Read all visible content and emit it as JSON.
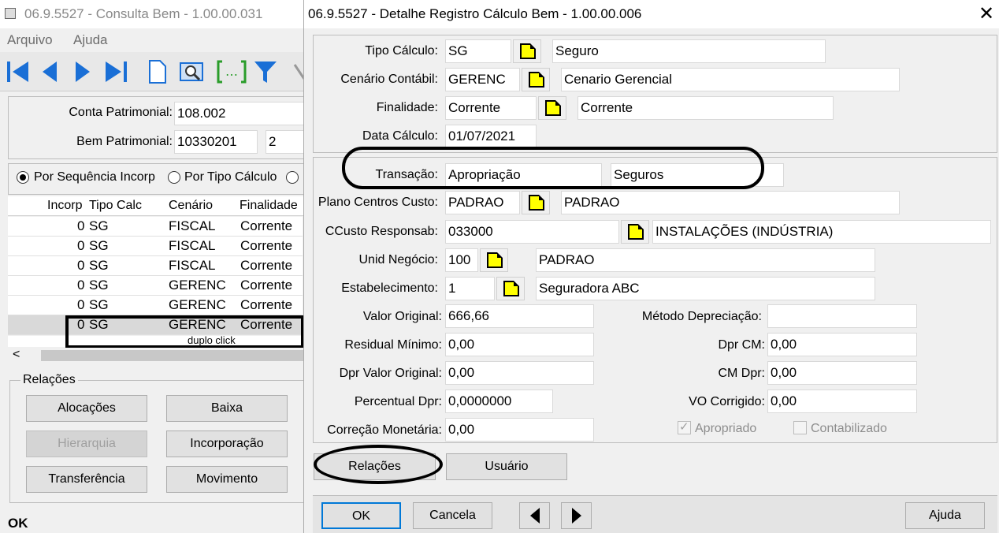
{
  "back_window": {
    "title": "06.9.5527 - Consulta Bem - 1.00.00.031",
    "menu": [
      "Arquivo",
      "Ajuda"
    ],
    "conta_patrimonial_label": "Conta Patrimonial:",
    "conta_patrimonial_value": "108.002",
    "bem_patrimonial_label": "Bem Patrimonial:",
    "bem_patrimonial_value": "10330201",
    "bem_seq_value": "2",
    "radios": [
      "Por Sequência Incorp",
      "Por Tipo Cálculo",
      ""
    ],
    "columns": [
      "Incorp",
      "Tipo Calc",
      "Cenário",
      "Finalidade"
    ],
    "rows": [
      [
        "0",
        "SG",
        "FISCAL",
        "Corrente"
      ],
      [
        "0",
        "SG",
        "FISCAL",
        "Corrente"
      ],
      [
        "0",
        "SG",
        "FISCAL",
        "Corrente"
      ],
      [
        "0",
        "SG",
        "GERENC",
        "Corrente"
      ],
      [
        "0",
        "SG",
        "GERENC",
        "Corrente"
      ],
      [
        "0",
        "SG",
        "GERENC",
        "Corrente"
      ]
    ],
    "annotation": "duplo click",
    "relacoes_group": "Relações",
    "buttons": {
      "alocacoes": "Alocações",
      "baixa": "Baixa",
      "hierarquia": "Hierarquia",
      "incorporacao": "Incorporação",
      "transferencia": "Transferência",
      "movimento": "Movimento"
    },
    "status": "OK"
  },
  "dialog": {
    "title": "06.9.5527 - Detalhe Registro Cálculo Bem - 1.00.00.006",
    "tipo_calculo": {
      "label": "Tipo Cálculo:",
      "code": "SG",
      "desc": "Seguro"
    },
    "cenario_contabil": {
      "label": "Cenário Contábil:",
      "code": "GERENC",
      "desc": "Cenario Gerencial"
    },
    "finalidade": {
      "label": "Finalidade:",
      "code": "Corrente",
      "desc": "Corrente"
    },
    "data_calculo": {
      "label": "Data Cálculo:",
      "value": "01/07/2021"
    },
    "transacao": {
      "label": "Transação:",
      "value": "Apropriação",
      "desc": "Seguros"
    },
    "plano_cc": {
      "label": "Plano Centros Custo:",
      "code": "PADRAO",
      "desc": "PADRAO"
    },
    "ccusto_resp": {
      "label": "CCusto Responsab:",
      "code": "033000",
      "desc": "INSTALAÇÕES (INDÚSTRIA)"
    },
    "unid_negocio": {
      "label": "Unid Negócio:",
      "code": "100",
      "desc": "PADRAO"
    },
    "estabelecimento": {
      "label": "Estabelecimento:",
      "code": "1",
      "desc": "Seguradora ABC"
    },
    "valor_original": {
      "label": "Valor Original:",
      "value": "666,66"
    },
    "residual_minimo": {
      "label": "Residual Mínimo:",
      "value": "0,00"
    },
    "dpr_valor_original": {
      "label": "Dpr Valor Original:",
      "value": "0,00"
    },
    "percentual_dpr": {
      "label": "Percentual Dpr:",
      "value": "0,0000000"
    },
    "correcao_monetaria": {
      "label": "Correção Monetária:",
      "value": "0,00"
    },
    "metodo_depreciacao": {
      "label": "Método Depreciação:",
      "value": ""
    },
    "dpr_cm": {
      "label": "Dpr CM:",
      "value": "0,00"
    },
    "cm_dpr": {
      "label": "CM Dpr:",
      "value": "0,00"
    },
    "vo_corrigido": {
      "label": "VO Corrigido:",
      "value": "0,00"
    },
    "apropriado_label": "Apropriado",
    "contabilizado_label": "Contabilizado",
    "relacoes_button": "Relações",
    "usuario_button": "Usuário",
    "ok_button": "OK",
    "cancela_button": "Cancela",
    "ajuda_button": "Ajuda"
  }
}
